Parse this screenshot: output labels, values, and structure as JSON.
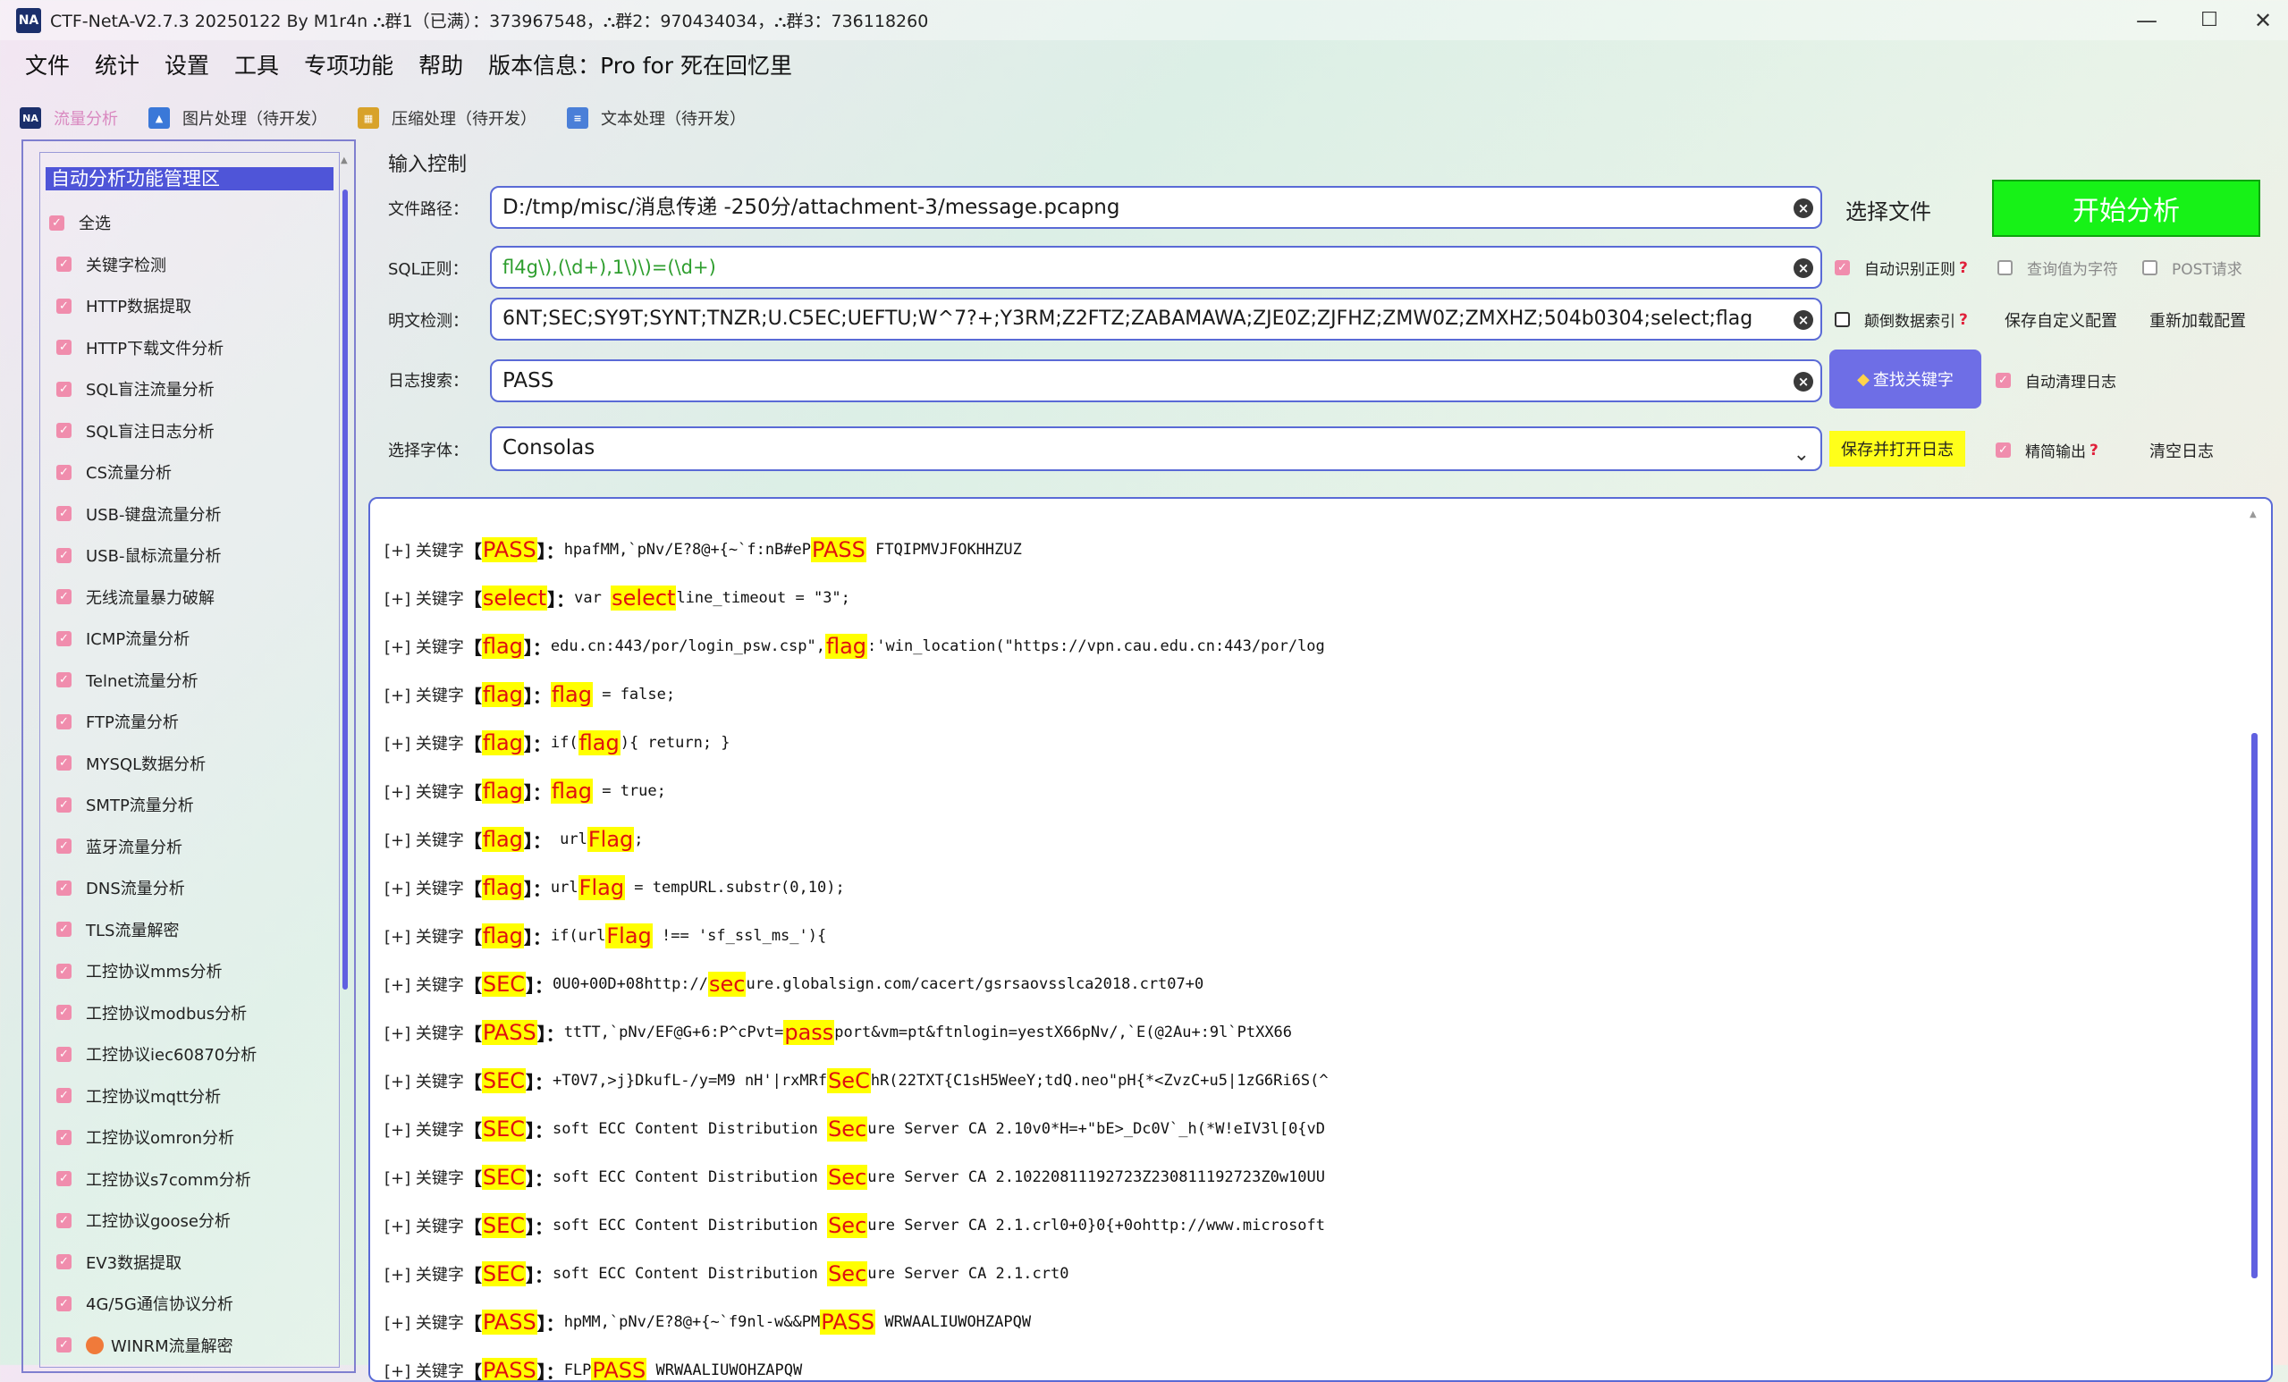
{
  "window": {
    "icon_text": "NA",
    "title": "CTF-NetA-V2.7.3 20250122 By M1r4n ⛬群1（已满）：373967548，⛬群2：970434034，⛬群3：736118260",
    "minimize": "—",
    "maximize": "☐",
    "close": "✕"
  },
  "menu": [
    "文件",
    "统计",
    "设置",
    "工具",
    "专项功能",
    "帮助",
    "版本信息：Pro for 死在回忆里"
  ],
  "tabs": [
    {
      "label": "流量分析",
      "icon": "netflow-icon",
      "active": true
    },
    {
      "label": "图片处理（待开发）",
      "icon": "image-icon",
      "active": false
    },
    {
      "label": "压缩处理（待开发）",
      "icon": "archive-icon",
      "active": false
    },
    {
      "label": "文本处理（待开发）",
      "icon": "document-icon",
      "active": false
    }
  ],
  "left_panel": {
    "header": "自动分析功能管理区",
    "select_all": "全选",
    "items": [
      "关键字检测",
      "HTTP数据提取",
      "HTTP下载文件分析",
      "SQL盲注流量分析",
      "SQL盲注日志分析",
      "CS流量分析",
      "USB-键盘流量分析",
      "USB-鼠标流量分析",
      "无线流量暴力破解",
      "ICMP流量分析",
      "Telnet流量分析",
      "FTP流量分析",
      "MYSQL数据分析",
      "SMTP流量分析",
      "蓝牙流量分析",
      "DNS流量分析",
      "TLS流量解密",
      "工控协议mms分析",
      "工控协议modbus分析",
      "工控协议iec60870分析",
      "工控协议mqtt分析",
      "工控协议omron分析",
      "工控协议s7comm分析",
      "工控协议goose分析",
      "EV3数据提取",
      "4G/5G通信协议分析",
      "WINRM流量解密"
    ]
  },
  "input_control": {
    "title": "输入控制",
    "file_path_label": "文件路径：",
    "file_path_value": "D:/tmp/misc/消息传递 -250分/attachment-3/message.pcapng",
    "select_file": "选择文件",
    "start_analysis": "开始分析",
    "regex_label": "SQL正则：",
    "regex_value": "fl4g\\),(\\d+),1\\)\\)=(\\d+)",
    "auto_regex": "自动识别正则",
    "query_as_char": "查询值为字符",
    "post_request": "POST请求",
    "plaintext_label": "明文检测：",
    "plaintext_value": "6NT;SEC;SY9T;SYNT;TNZR;U.C5EC;UEFTU;W^7?+;Y3RM;Z2FTZ;ZABAMAWA;ZJE0Z;ZJFHZ;ZMW0Z;ZMXHZ;504b0304;select;flag",
    "reverse_index": "颠倒数据索引",
    "save_custom_config": "保存自定义配置",
    "reload_config": "重新加载配置",
    "log_search_label": "日志搜索：",
    "log_search_value": "PASS",
    "find_keyword": "查找关键字",
    "auto_clear_log": "自动清理日志",
    "font_label": "选择字体：",
    "font_value": "Consolas",
    "save_open_log": "保存并打开日志",
    "concise_output": "精简输出",
    "clear_log": "清空日志",
    "help_mark": "?"
  },
  "log": {
    "prefix": "[+] 关键字",
    "lines": [
      {
        "kw": "PASS",
        "parts": [
          [
            "hpafMM,`pNv/E?8@+{~`f:nB#eP",
            0
          ],
          [
            "PASS",
            1
          ],
          [
            " FTQIPMVJFOKHHZUZ",
            0
          ]
        ]
      },
      {
        "kw": "select",
        "parts": [
          [
            "var ",
            0
          ],
          [
            "select",
            1
          ],
          [
            "line_timeout = \"3\";",
            0
          ]
        ]
      },
      {
        "kw": "flag",
        "parts": [
          [
            "edu.cn:443/por/login_psw.csp\",",
            0
          ],
          [
            "flag",
            1
          ],
          [
            ":'win_location(\"https://vpn.cau.edu.cn:443/por/log",
            0
          ]
        ]
      },
      {
        "kw": "flag",
        "parts": [
          [
            "flag",
            1
          ],
          [
            " = false;",
            0
          ]
        ]
      },
      {
        "kw": "flag",
        "parts": [
          [
            "if(",
            0
          ],
          [
            "flag",
            1
          ],
          [
            "){ return; }",
            0
          ]
        ]
      },
      {
        "kw": "flag",
        "parts": [
          [
            "flag",
            1
          ],
          [
            " = true;",
            0
          ]
        ]
      },
      {
        "kw": "flag",
        "parts": [
          [
            " url",
            0
          ],
          [
            "Flag",
            1
          ],
          [
            ";",
            0
          ]
        ]
      },
      {
        "kw": "flag",
        "parts": [
          [
            "url",
            0
          ],
          [
            "Flag",
            1
          ],
          [
            " = tempURL.substr(0,10);",
            0
          ]
        ]
      },
      {
        "kw": "flag",
        "parts": [
          [
            "if(url",
            0
          ],
          [
            "Flag",
            1
          ],
          [
            " !== 'sf_ssl_ms_'){",
            0
          ]
        ]
      },
      {
        "kw": "SEC",
        "parts": [
          [
            "0U0+00D+08http://",
            0
          ],
          [
            "sec",
            1
          ],
          [
            "ure.globalsign.com/cacert/gsrsaovsslca2018.crt07+0",
            0
          ]
        ]
      },
      {
        "kw": "PASS",
        "parts": [
          [
            "ttTT,`pNv/EF@G+6:P^cPvt=",
            0
          ],
          [
            "pass",
            1
          ],
          [
            "port&vm=pt&ftnlogin=yestX66pNv/,`E(@2Au+:9l`PtXX66",
            0
          ]
        ]
      },
      {
        "kw": "SEC",
        "parts": [
          [
            "+T0V7,>j}DkufL-/y=M9 nH'|rxMRf",
            0
          ],
          [
            "SeC",
            1
          ],
          [
            "hR(22TXT{C1sH5WeeY;tdQ.neo\"pH{*<ZvzC+u5|1zG6Ri6S(^",
            0
          ]
        ]
      },
      {
        "kw": "SEC",
        "parts": [
          [
            "soft ECC Content Distribution ",
            0
          ],
          [
            "Sec",
            1
          ],
          [
            "ure Server CA 2.10v0*H=+\"bE>_Dc0V`_h(*W!eIV3l[0{vD",
            0
          ]
        ]
      },
      {
        "kw": "SEC",
        "parts": [
          [
            "soft ECC Content Distribution ",
            0
          ],
          [
            "Sec",
            1
          ],
          [
            "ure Server CA 2.10220811192723Z230811192723Z0w10UU",
            0
          ]
        ]
      },
      {
        "kw": "SEC",
        "parts": [
          [
            "soft ECC Content Distribution ",
            0
          ],
          [
            "Sec",
            1
          ],
          [
            "ure Server CA 2.1.crl0+0}0{+0ohttp://www.microsoft",
            0
          ]
        ]
      },
      {
        "kw": "SEC",
        "parts": [
          [
            "soft ECC Content Distribution ",
            0
          ],
          [
            "Sec",
            1
          ],
          [
            "ure Server CA 2.1.crt0",
            0
          ]
        ]
      },
      {
        "kw": "PASS",
        "parts": [
          [
            "hpMM,`pNv/E?8@+{~`f9nl-w&&PM",
            0
          ],
          [
            "PASS",
            1
          ],
          [
            " WRWAALIUWOHZAPQW",
            0
          ]
        ]
      },
      {
        "kw": "PASS",
        "parts": [
          [
            "FLP",
            0
          ],
          [
            "PASS",
            1
          ],
          [
            " WRWAALIUWOHZAPQW",
            0
          ]
        ]
      }
    ]
  }
}
